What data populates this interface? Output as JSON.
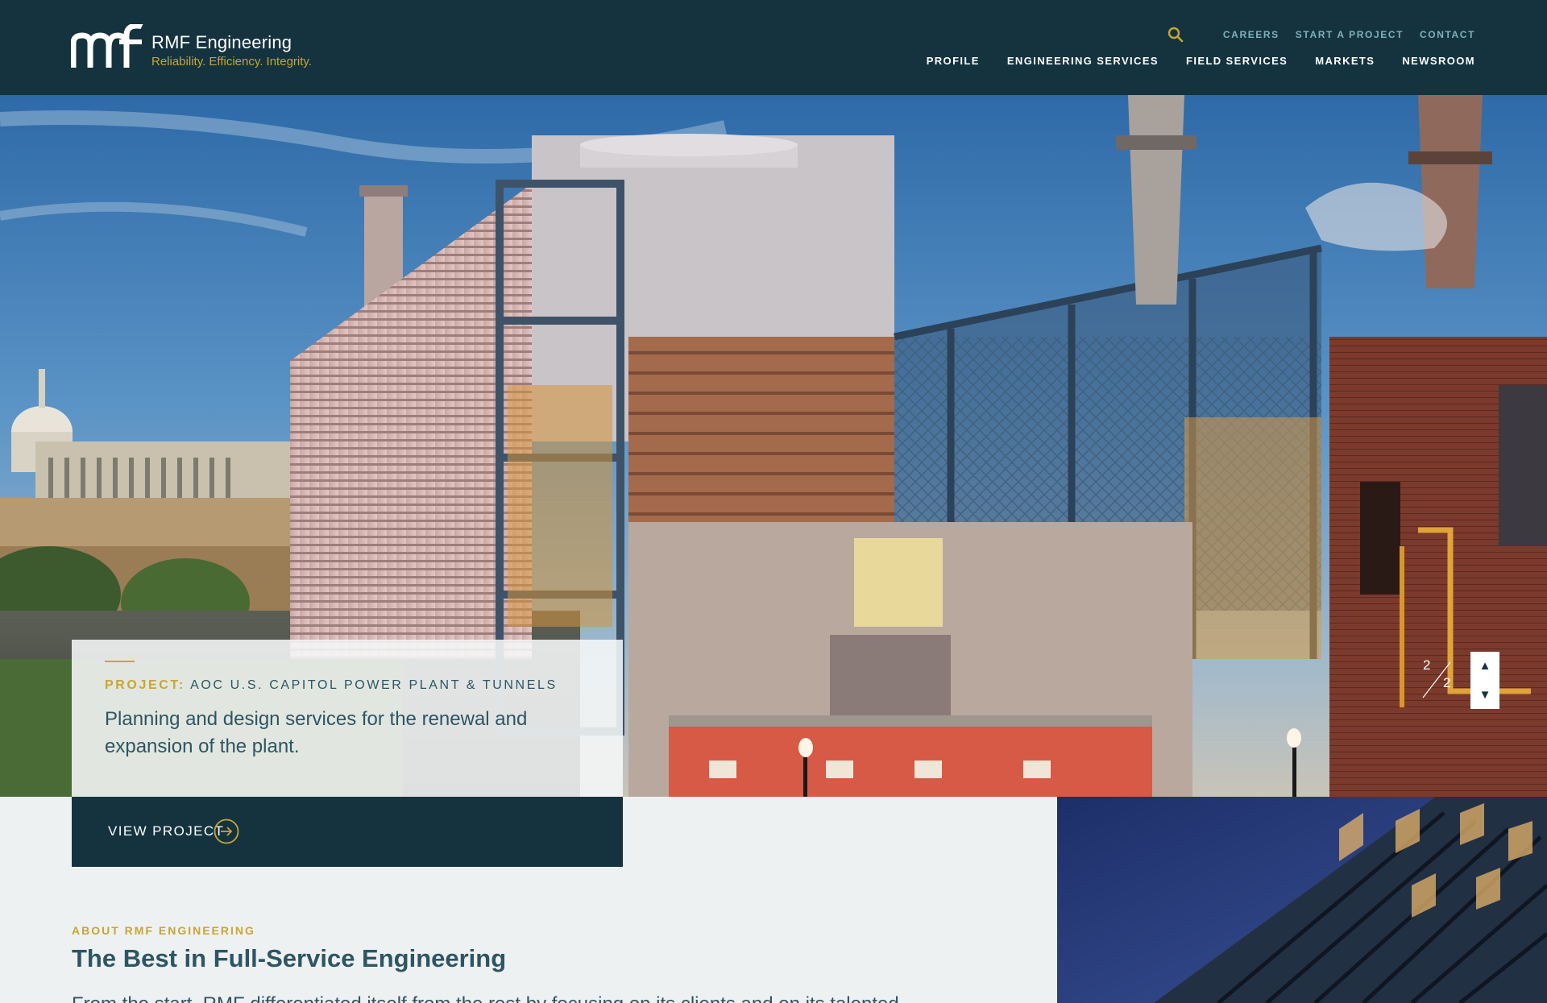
{
  "brand": {
    "name": "RMF Engineering",
    "tagline": "Reliability. Efficiency. Integrity.",
    "colors": {
      "navy": "#14333f",
      "gold": "#c9a534",
      "teal_link": "#7fb0bc",
      "text_blue": "#2d5563"
    }
  },
  "header": {
    "search_icon": "search-icon",
    "utility_links": [
      "CAREERS",
      "START A PROJECT",
      "CONTACT"
    ],
    "main_nav": [
      "PROFILE",
      "ENGINEERING SERVICES",
      "FIELD SERVICES",
      "MARKETS",
      "NEWSROOM"
    ]
  },
  "hero": {
    "project_label": "PROJECT:",
    "project_name": "AOC U.S. CAPITOL POWER PLANT & TUNNELS",
    "description": "Planning and design services for the renewal and expansion of the plant.",
    "slide_current": "2",
    "slide_total": "2",
    "prev_icon": "triangle-up-icon",
    "next_icon": "triangle-down-icon",
    "view_label": "VIEW PROJECT",
    "view_icon": "arrow-right-circle-icon"
  },
  "about": {
    "kicker": "ABOUT RMF ENGINEERING",
    "title": "The Best in Full-Service Engineering",
    "body_partial": "From the start, RMF differentiated itself from the rest by focusing on its clients and on its talented"
  }
}
